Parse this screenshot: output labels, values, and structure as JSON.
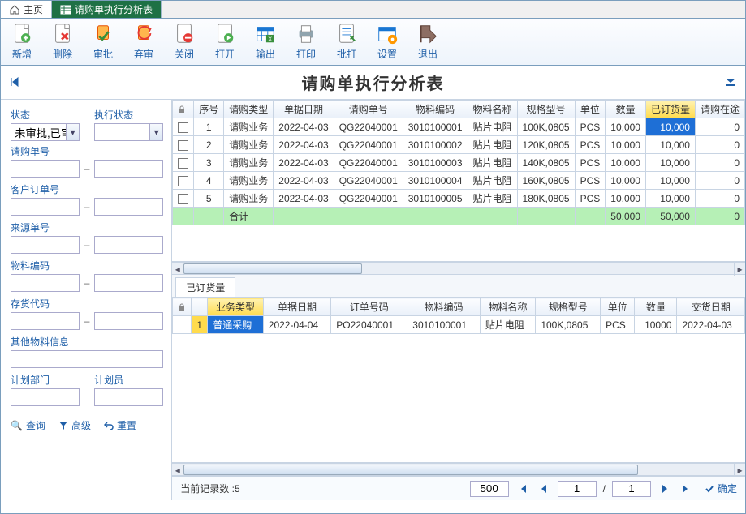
{
  "tabs": {
    "home": "主页",
    "active": "请购单执行分析表"
  },
  "toolbar": [
    {
      "id": "new",
      "label": "新增"
    },
    {
      "id": "delete",
      "label": "删除"
    },
    {
      "id": "approve",
      "label": "审批"
    },
    {
      "id": "reject",
      "label": "弃审"
    },
    {
      "id": "close",
      "label": "关闭"
    },
    {
      "id": "open",
      "label": "打开"
    },
    {
      "id": "export",
      "label": "输出"
    },
    {
      "id": "print",
      "label": "打印"
    },
    {
      "id": "batch",
      "label": "批打"
    },
    {
      "id": "settings",
      "label": "设置"
    },
    {
      "id": "exit",
      "label": "退出"
    }
  ],
  "title": "请购单执行分析表",
  "filters": {
    "status_label": "状态",
    "status_value": "未审批,已审批",
    "exec_label": "执行状态",
    "exec_value": "",
    "req_no_label": "请购单号",
    "cust_order_label": "客户订单号",
    "source_no_label": "来源单号",
    "mat_code_label": "物料编码",
    "stock_code_label": "存货代码",
    "other_mat_label": "其他物料信息",
    "plan_dept_label": "计划部门",
    "planner_label": "计划员"
  },
  "sidebar_actions": {
    "query": "查询",
    "advanced": "高级",
    "reset": "重置"
  },
  "grid_cols": [
    "序号",
    "请购类型",
    "单据日期",
    "请购单号",
    "物料编码",
    "物料名称",
    "规格型号",
    "单位",
    "数量",
    "已订货量",
    "请购在途"
  ],
  "grid_rows": [
    {
      "n": "1",
      "type": "请购业务",
      "date": "2022-04-03",
      "no": "QG22040001",
      "mat": "3010100001",
      "name": "贴片电阻",
      "spec": "100K,0805",
      "unit": "PCS",
      "qty": "10,000",
      "ordered": "10,000",
      "transit": "0"
    },
    {
      "n": "2",
      "type": "请购业务",
      "date": "2022-04-03",
      "no": "QG22040001",
      "mat": "3010100002",
      "name": "贴片电阻",
      "spec": "120K,0805",
      "unit": "PCS",
      "qty": "10,000",
      "ordered": "10,000",
      "transit": "0"
    },
    {
      "n": "3",
      "type": "请购业务",
      "date": "2022-04-03",
      "no": "QG22040001",
      "mat": "3010100003",
      "name": "贴片电阻",
      "spec": "140K,0805",
      "unit": "PCS",
      "qty": "10,000",
      "ordered": "10,000",
      "transit": "0"
    },
    {
      "n": "4",
      "type": "请购业务",
      "date": "2022-04-03",
      "no": "QG22040001",
      "mat": "3010100004",
      "name": "贴片电阻",
      "spec": "160K,0805",
      "unit": "PCS",
      "qty": "10,000",
      "ordered": "10,000",
      "transit": "0"
    },
    {
      "n": "5",
      "type": "请购业务",
      "date": "2022-04-03",
      "no": "QG22040001",
      "mat": "3010100005",
      "name": "贴片电阻",
      "spec": "180K,0805",
      "unit": "PCS",
      "qty": "10,000",
      "ordered": "10,000",
      "transit": "0"
    }
  ],
  "grid_total": {
    "label": "合计",
    "qty": "50,000",
    "ordered": "50,000",
    "transit": "0"
  },
  "subtab": "已订货量",
  "grid2_cols": [
    "业务类型",
    "单据日期",
    "订单号码",
    "物料编码",
    "物料名称",
    "规格型号",
    "单位",
    "数量",
    "交货日期"
  ],
  "grid2_row": {
    "type": "普通采购",
    "date": "2022-04-04",
    "order": "PO22040001",
    "mat": "3010100001",
    "name": "贴片电阻",
    "spec": "100K,0805",
    "unit": "PCS",
    "qty": "10000",
    "deliv": "2022-04-03"
  },
  "status": {
    "records_label": "当前记录数",
    "records_count": "5",
    "page_size": "500",
    "page": "1",
    "pages": "1",
    "confirm": "确定",
    "sep": "/"
  }
}
